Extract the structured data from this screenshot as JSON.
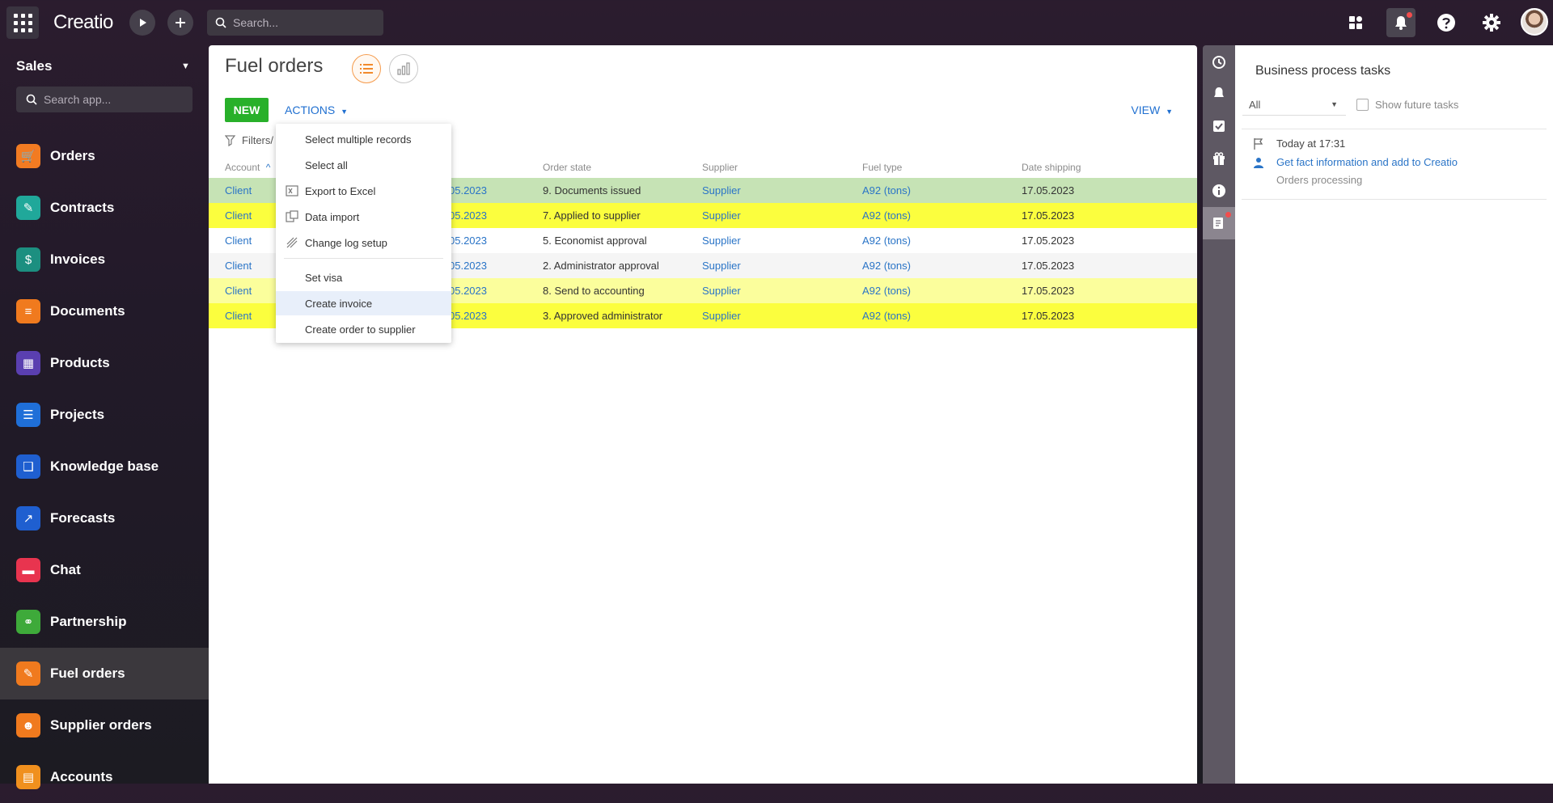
{
  "topbar": {
    "logo": "Creatio",
    "search_placeholder": "Search..."
  },
  "sidebar": {
    "workspace": "Sales",
    "search_placeholder": "Search app...",
    "items": [
      {
        "label": "Orders",
        "icon": "cart-icon",
        "color": "#f27b22"
      },
      {
        "label": "Contracts",
        "icon": "contract-icon",
        "color": "#20a89a"
      },
      {
        "label": "Invoices",
        "icon": "invoice-icon",
        "color": "#1c8f80"
      },
      {
        "label": "Documents",
        "icon": "document-icon",
        "color": "#f07a1e"
      },
      {
        "label": "Products",
        "icon": "products-icon",
        "color": "#5a3fb0"
      },
      {
        "label": "Projects",
        "icon": "projects-icon",
        "color": "#1f6fd8"
      },
      {
        "label": "Knowledge base",
        "icon": "book-icon",
        "color": "#1f5fd0"
      },
      {
        "label": "Forecasts",
        "icon": "forecast-chart-icon",
        "color": "#1f5fd0"
      },
      {
        "label": "Chat",
        "icon": "chat-icon",
        "color": "#e8344f"
      },
      {
        "label": "Partnership",
        "icon": "handshake-icon",
        "color": "#3eaa3a"
      },
      {
        "label": "Fuel orders",
        "icon": "fuel-order-icon",
        "color": "#f07a1e",
        "active": true
      },
      {
        "label": "Supplier orders",
        "icon": "supplier-icon",
        "color": "#f07a1e"
      },
      {
        "label": "Accounts",
        "icon": "accounts-icon",
        "color": "#f0901e"
      }
    ]
  },
  "main": {
    "title": "Fuel orders",
    "new_label": "NEW",
    "actions_label": "ACTIONS",
    "view_label": "VIEW",
    "filters_label": "Filters/",
    "columns": [
      "Account",
      "Order state",
      "Supplier",
      "Fuel type",
      "Date shipping"
    ],
    "rows": [
      {
        "account": "Client",
        "date": "05.2023",
        "state": "9. Documents issued",
        "supplier": "Supplier",
        "fuel": "A92 (tons)",
        "shipping": "17.05.2023",
        "bg": "#c6e3b5"
      },
      {
        "account": "Client",
        "date": "05.2023",
        "state": "7. Applied to supplier",
        "supplier": "Supplier",
        "fuel": "A92 (tons)",
        "shipping": "17.05.2023",
        "bg": "#fbfe3e"
      },
      {
        "account": "Client",
        "date": "05.2023",
        "state": "5. Economist approval",
        "supplier": "Supplier",
        "fuel": "A92 (tons)",
        "shipping": "17.05.2023",
        "bg": "#ffffff"
      },
      {
        "account": "Client",
        "date": "05.2023",
        "state": "2. Administrator approval",
        "supplier": "Supplier",
        "fuel": "A92 (tons)",
        "shipping": "17.05.2023",
        "bg": "#f5f5f5"
      },
      {
        "account": "Client",
        "date": "05.2023",
        "state": "8. Send to accounting",
        "supplier": "Supplier",
        "fuel": "A92 (tons)",
        "shipping": "17.05.2023",
        "bg": "#fbfe9c"
      },
      {
        "account": "Client",
        "date": "05.2023",
        "state": "3. Approved administrator",
        "supplier": "Supplier",
        "fuel": "A92 (tons)",
        "shipping": "17.05.2023",
        "bg": "#fbfe3e"
      }
    ]
  },
  "actions_menu": {
    "select_multiple": "Select multiple records",
    "select_all": "Select all",
    "export_excel": "Export to Excel",
    "data_import": "Data import",
    "change_log": "Change log setup",
    "set_visa": "Set visa",
    "create_invoice": "Create invoice",
    "create_order_supplier": "Create order to supplier"
  },
  "tasks_panel": {
    "title": "Business process tasks",
    "filter_value": "All",
    "show_future_label": "Show future tasks",
    "task": {
      "time": "Today at 17:31",
      "title": "Get fact information and add to Creatio",
      "process": "Orders processing"
    }
  }
}
